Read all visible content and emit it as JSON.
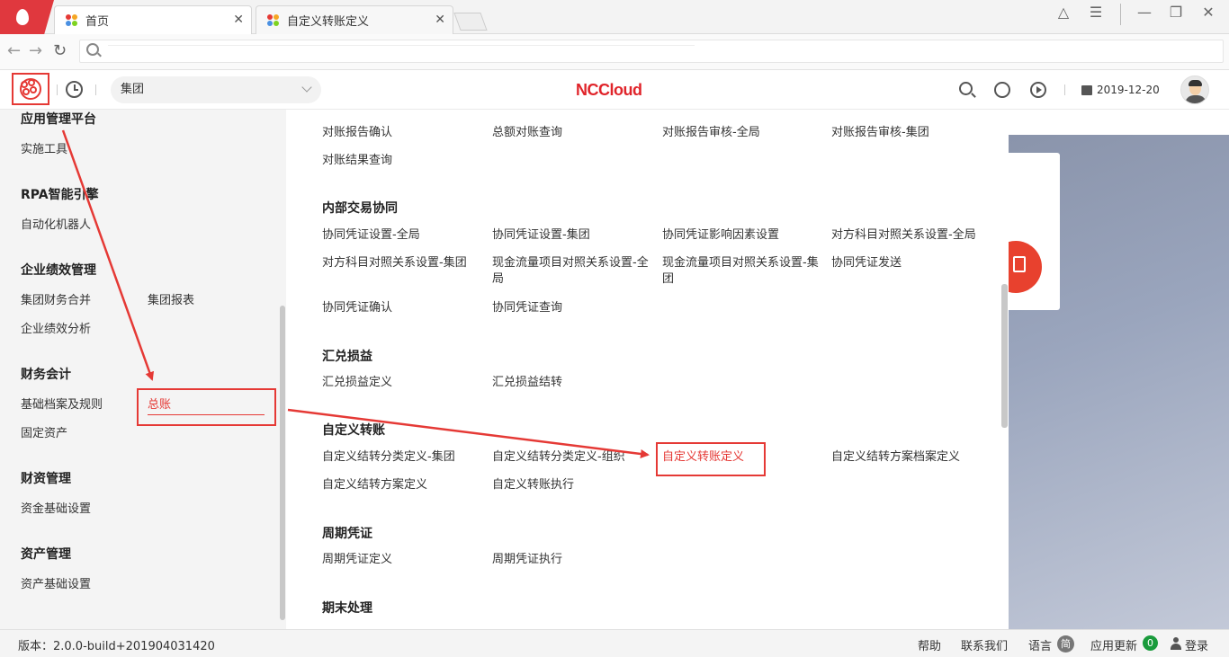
{
  "browser": {
    "tabs": [
      {
        "label": "首页"
      },
      {
        "label": "自定义转账定义"
      }
    ],
    "close_glyph": "✕",
    "window_controls": [
      "△",
      "☰",
      "—",
      "❐",
      "✕"
    ]
  },
  "address_bar": {
    "url": ""
  },
  "header": {
    "group_select": "集团",
    "brand": "NCCloud",
    "date": "2019-12-20"
  },
  "sidebar": {
    "sections": [
      {
        "title": "应用管理平台",
        "items": [
          "实施工具"
        ]
      },
      {
        "title": "RPA智能引擎",
        "items": [
          "自动化机器人"
        ]
      },
      {
        "title": "企业绩效管理",
        "items": [
          "集团财务合并",
          "集团报表",
          "企业绩效分析"
        ]
      },
      {
        "title": "财务会计",
        "items": [
          "基础档案及规则",
          "总账",
          "固定资产"
        ]
      },
      {
        "title": "财资管理",
        "items": [
          "资金基础设置"
        ]
      },
      {
        "title": "资产管理",
        "items": [
          "资产基础设置"
        ]
      }
    ]
  },
  "menu": {
    "top_items": [
      "对账报告确认",
      "总额对账查询",
      "对账报告审核-全局",
      "对账报告审核-集团",
      "对账结果查询"
    ],
    "groups": [
      {
        "title": "内部交易协同",
        "items": [
          "协同凭证设置-全局",
          "协同凭证设置-集团",
          "协同凭证影响因素设置",
          "对方科目对照关系设置-全局",
          "对方科目对照关系设置-集团",
          "现金流量项目对照关系设置-全局",
          "现金流量项目对照关系设置-集团",
          "协同凭证发送",
          "协同凭证确认",
          "协同凭证查询"
        ]
      },
      {
        "title": "汇兑损益",
        "items": [
          "汇兑损益定义",
          "汇兑损益结转"
        ]
      },
      {
        "title": "自定义转账",
        "items": [
          "自定义结转分类定义-集团",
          "自定义结转分类定义-组织",
          "自定义转账定义",
          "自定义结转方案档案定义",
          "自定义结转方案定义",
          "自定义转账执行"
        ]
      },
      {
        "title": "周期凭证",
        "items": [
          "周期凭证定义",
          "周期凭证执行"
        ]
      },
      {
        "title": "期末处理",
        "items": []
      }
    ]
  },
  "statusbar": {
    "version": "版本：2.0.0-build+201904031420",
    "help": "帮助",
    "contact": "联系我们",
    "language": "语言",
    "language_badge": "简",
    "update": "应用更新",
    "update_count": "0",
    "login": "登录"
  },
  "colors": {
    "brand_red": "#e0242a",
    "highlight_red": "#e53935",
    "sidebar_bg": "#f4f4f4",
    "update_badge": "#1a9b3c"
  }
}
